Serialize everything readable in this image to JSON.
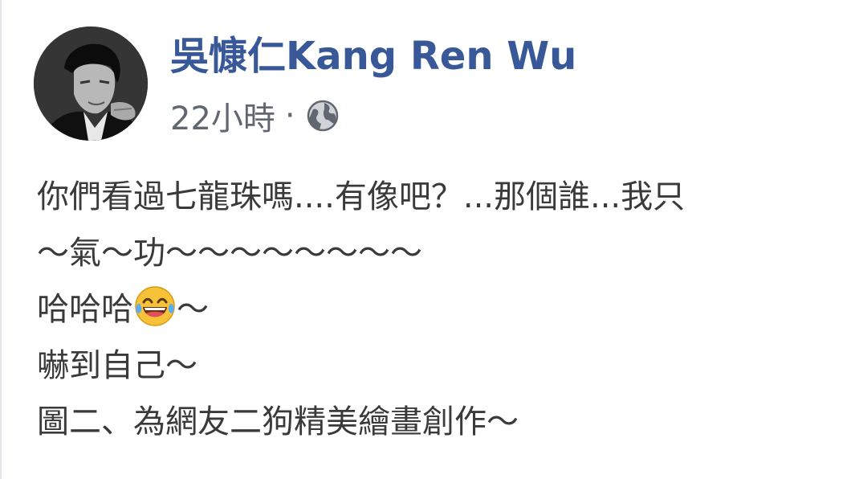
{
  "author": {
    "name": "吳慷仁Kang Ren Wu",
    "avatar_icon": "profile-photo"
  },
  "meta": {
    "timestamp": "22小時",
    "separator": "·",
    "audience_icon": "globe-icon"
  },
  "post": {
    "lines": [
      "你們看過七龍珠嗎....有像吧？...那個誰...我只",
      "～氣～功～～～～～～～～",
      "哈哈哈",
      "嚇到自己～",
      "圖二、為網友二狗精美繪畫創作～"
    ],
    "line3_suffix": "～",
    "emoji": "tears-of-joy-emoji"
  },
  "colors": {
    "name": "#385898",
    "meta": "#606770",
    "body_text": "#3a3a3a"
  }
}
